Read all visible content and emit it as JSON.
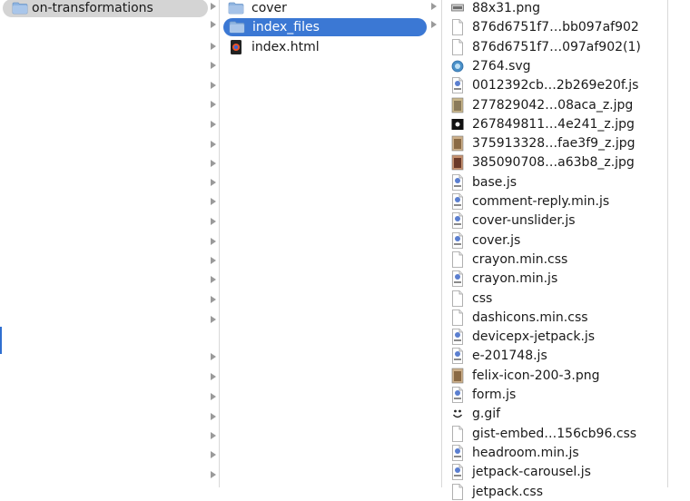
{
  "columns": {
    "col1": {
      "items": [
        {
          "label": "on-transformations",
          "kind": "folder",
          "selected": true
        }
      ]
    },
    "col2": {
      "items": [
        {
          "label": "cover",
          "kind": "folder",
          "selected": false
        },
        {
          "label": "index_files",
          "kind": "folder",
          "selected": true
        },
        {
          "label": "index.html",
          "kind": "html",
          "selected": false
        }
      ]
    },
    "col3": {
      "items": [
        {
          "label": "88x31.png",
          "kind": "image-banner"
        },
        {
          "label": "876d6751f7…bb097af902",
          "kind": "doc"
        },
        {
          "label": "876d6751f7…097af902(1)",
          "kind": "doc"
        },
        {
          "label": "2764.svg",
          "kind": "svg"
        },
        {
          "label": "0012392cb…2b269e20f.js",
          "kind": "text"
        },
        {
          "label": "277829042…08aca_z.jpg",
          "kind": "image-landscape"
        },
        {
          "label": "267849811…4e241_z.jpg",
          "kind": "image-dark"
        },
        {
          "label": "375913328…fae3f9_z.jpg",
          "kind": "image-portrait"
        },
        {
          "label": "385090708…a63b8_z.jpg",
          "kind": "image-photo"
        },
        {
          "label": "base.js",
          "kind": "text"
        },
        {
          "label": "comment-reply.min.js",
          "kind": "text"
        },
        {
          "label": "cover-unslider.js",
          "kind": "text"
        },
        {
          "label": "cover.js",
          "kind": "text"
        },
        {
          "label": "crayon.min.css",
          "kind": "doc"
        },
        {
          "label": "crayon.min.js",
          "kind": "text"
        },
        {
          "label": "css",
          "kind": "doc"
        },
        {
          "label": "dashicons.min.css",
          "kind": "doc"
        },
        {
          "label": "devicepx-jetpack.js",
          "kind": "text"
        },
        {
          "label": "e-201748.js",
          "kind": "text"
        },
        {
          "label": "felix-icon-200-3.png",
          "kind": "image-portrait"
        },
        {
          "label": "form.js",
          "kind": "text"
        },
        {
          "label": "g.gif",
          "kind": "smiley"
        },
        {
          "label": "gist-embed…156cb96.css",
          "kind": "doc"
        },
        {
          "label": "headroom.min.js",
          "kind": "text"
        },
        {
          "label": "jetpack-carousel.js",
          "kind": "text"
        },
        {
          "label": "jetpack.css",
          "kind": "doc"
        }
      ]
    }
  },
  "colors": {
    "selection_active": "#3b78d4",
    "selection_inactive": "#d4d4d4",
    "folder": "#8fb4e0",
    "arrow": "#9a9a9a"
  },
  "icons": {
    "folder": "folder-icon",
    "html": "html-file-icon",
    "doc": "document-icon",
    "text": "text-file-icon",
    "svg": "svg-file-icon",
    "image": "image-thumbnail-icon",
    "smiley": "gif-smiley-icon",
    "disclosure": "disclosure-arrow-icon"
  }
}
